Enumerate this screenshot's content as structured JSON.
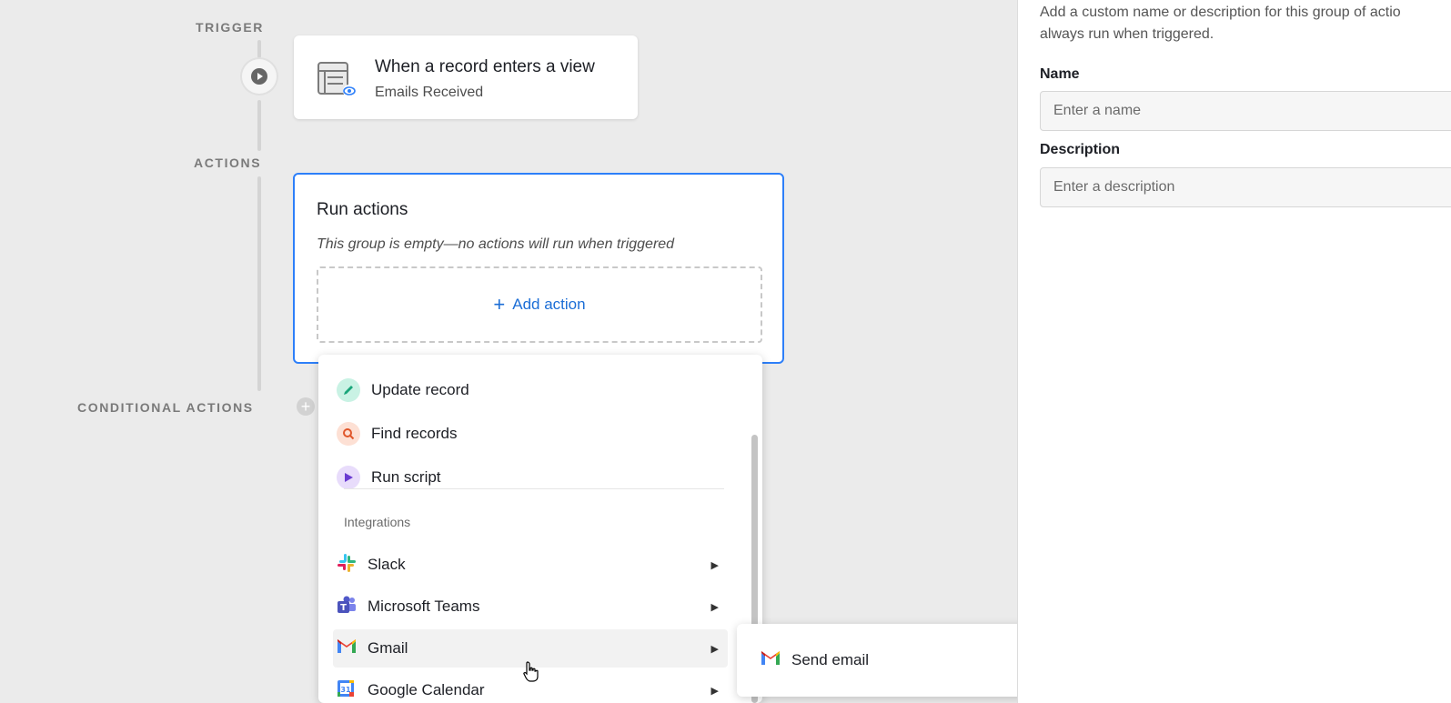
{
  "canvas": {
    "trigger_label": "TRIGGER",
    "actions_label": "ACTIONS",
    "conditional_label": "CONDITIONAL ACTIONS",
    "trigger_card": {
      "title": "When a record enters a view",
      "subtitle": "Emails Received",
      "icon": "table-view-icon"
    },
    "actions_card": {
      "title": "Run actions",
      "empty_text": "This group is empty—no actions will run when triggered",
      "add_label": "Add action"
    }
  },
  "action_menu": {
    "items": [
      {
        "label": "Update record",
        "icon": "pencil-icon",
        "color": "#20c997"
      },
      {
        "label": "Find records",
        "icon": "search-icon",
        "color": "#f26b3a"
      },
      {
        "label": "Run script",
        "icon": "play-icon",
        "color": "#7c4dde"
      }
    ],
    "integrations_label": "Integrations",
    "integrations": [
      {
        "label": "Slack",
        "icon": "slack-icon"
      },
      {
        "label": "Microsoft Teams",
        "icon": "teams-icon"
      },
      {
        "label": "Gmail",
        "icon": "gmail-icon"
      },
      {
        "label": "Google Calendar",
        "icon": "google-calendar-icon"
      }
    ],
    "highlighted": "Gmail"
  },
  "submenu": {
    "items": [
      {
        "label": "Send email",
        "icon": "gmail-icon"
      }
    ]
  },
  "panel": {
    "description": "Add a custom name or description for this group of actio",
    "description_line2": "always run when triggered.",
    "name_label": "Name",
    "name_placeholder": "Enter a name",
    "description_label": "Description",
    "description_placeholder": "Enter a description"
  },
  "colors": {
    "accent": "#2d7ff9",
    "link": "#1c6ed6"
  }
}
